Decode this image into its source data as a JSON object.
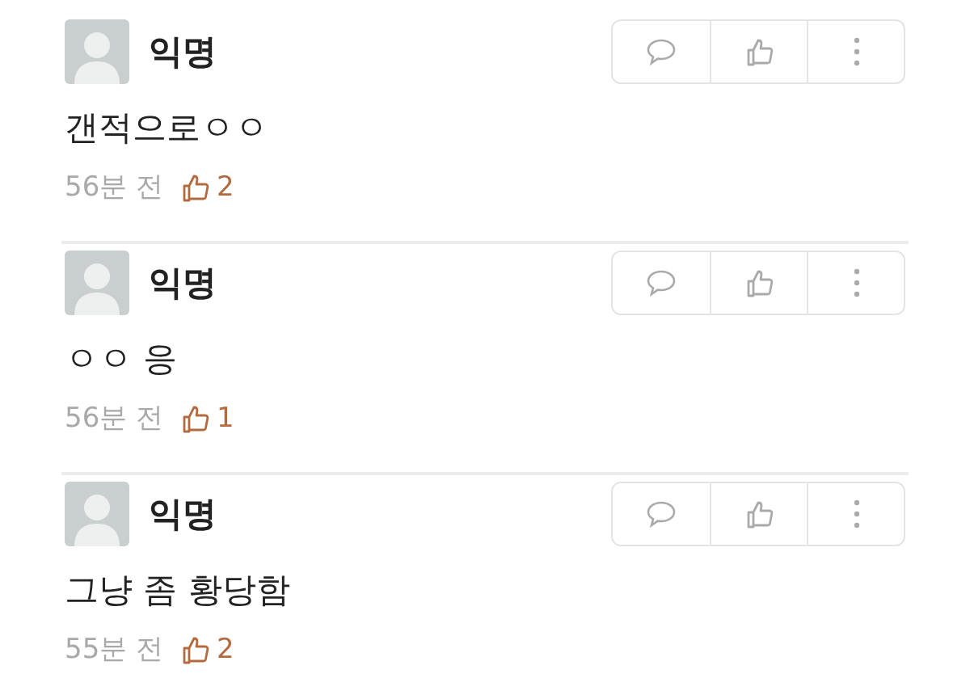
{
  "comments": [
    {
      "author": "익명",
      "body": "갠적으로ㅇㅇ",
      "time": "56분 전",
      "likes": "2"
    },
    {
      "author": "익명",
      "body": "ㅇㅇ 응",
      "time": "56분 전",
      "likes": "1"
    },
    {
      "author": "익명",
      "body": "그냥 좀 황당함",
      "time": "55분 전",
      "likes": "2"
    }
  ]
}
